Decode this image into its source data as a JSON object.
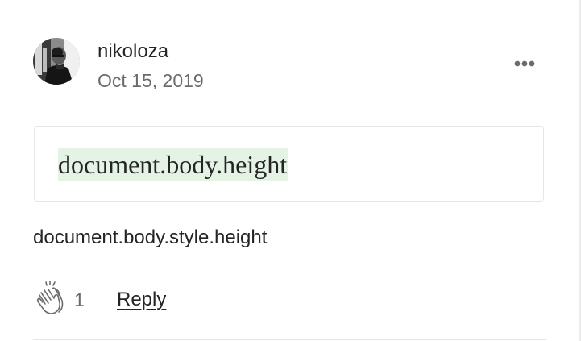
{
  "comment": {
    "author": {
      "name": "nikoloza",
      "avatar_icon": "user-photo-avatar"
    },
    "date": "Oct 15, 2019",
    "more_icon": "more-options-icon",
    "highlight": {
      "text": "document.body.height",
      "background": "#e4f3e4"
    },
    "body": "document.body.style.height",
    "actions": {
      "clap_icon": "clap-icon",
      "clap_count": "1",
      "reply_label": "Reply"
    }
  },
  "colors": {
    "text_primary": "#242424",
    "text_secondary": "#6b6b6b",
    "border": "#e6e6e6"
  }
}
